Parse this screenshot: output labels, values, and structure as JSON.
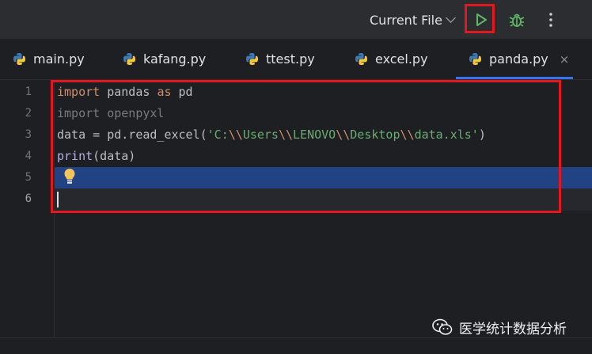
{
  "toolbar": {
    "run_config_label": "Current File",
    "icons": [
      "chevron-down-icon",
      "run-icon",
      "debug-icon",
      "more-vertical-icon"
    ]
  },
  "tabs": [
    {
      "label": "main.py"
    },
    {
      "label": "kafang.py"
    },
    {
      "label": "ttest.py"
    },
    {
      "label": "excel.py"
    },
    {
      "label": "panda.py",
      "active": true
    }
  ],
  "tab_close_glyph": "×",
  "editor": {
    "line_numbers": [
      "1",
      "2",
      "3",
      "4",
      "5",
      "6"
    ],
    "current_line": 6,
    "lines": [
      [
        {
          "t": "import",
          "c": "kw"
        },
        {
          "t": " pandas ",
          "c": ""
        },
        {
          "t": "as",
          "c": "kw"
        },
        {
          "t": " pd",
          "c": ""
        }
      ],
      [
        {
          "t": "import openpyxl",
          "c": "kw-dim"
        }
      ],
      [
        {
          "t": "data = pd.read_excel(",
          "c": ""
        },
        {
          "t": "'C:",
          "c": "str"
        },
        {
          "t": "\\\\",
          "c": "esc"
        },
        {
          "t": "Users",
          "c": "str"
        },
        {
          "t": "\\\\",
          "c": "esc"
        },
        {
          "t": "LENOVO",
          "c": "str"
        },
        {
          "t": "\\\\",
          "c": "esc"
        },
        {
          "t": "Desktop",
          "c": "str"
        },
        {
          "t": "\\\\",
          "c": "esc"
        },
        {
          "t": "data.xls'",
          "c": "str"
        },
        {
          "t": ")",
          "c": ""
        }
      ],
      [
        {
          "t": "print",
          "c": "fn"
        },
        {
          "t": "(data)",
          "c": ""
        }
      ],
      [],
      []
    ]
  },
  "watermark": {
    "text": "医学统计数据分析",
    "icon": "wechat-icon"
  },
  "colors": {
    "highlight": "#e3171e",
    "selection": "#214283",
    "accent": "#3574f0"
  }
}
